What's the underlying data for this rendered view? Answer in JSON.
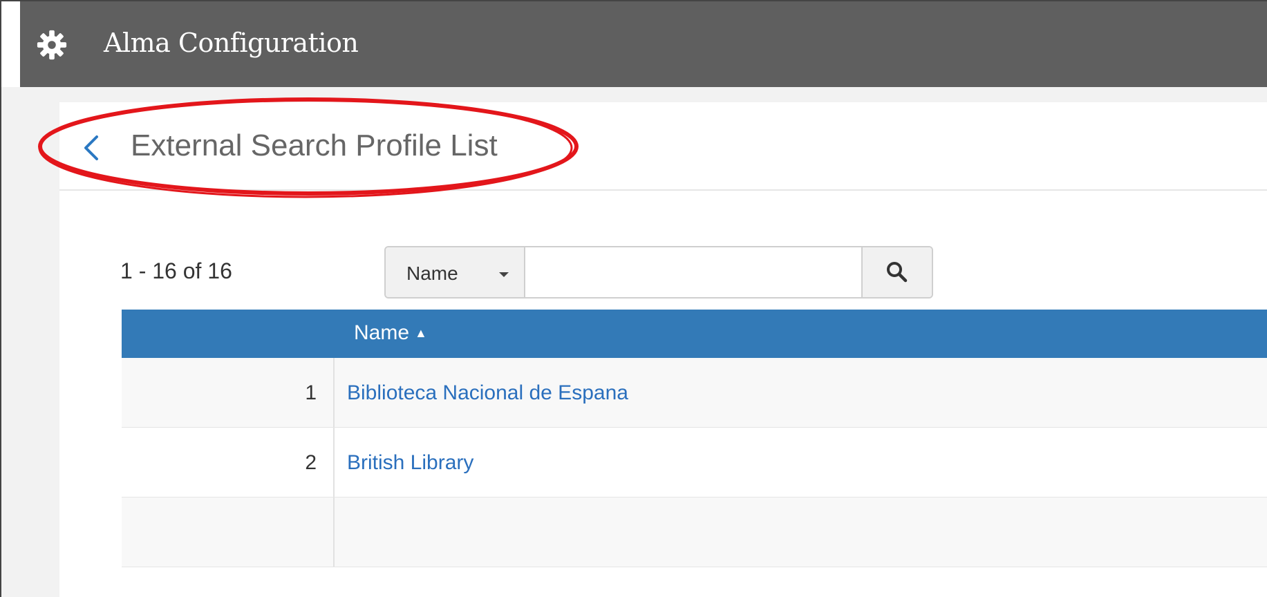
{
  "topbar": {
    "app_title": "Alma Configuration",
    "icon": "gear-icon",
    "background_color": "#5f5f5f"
  },
  "header": {
    "back_icon": "chevron-left-icon",
    "page_title": "External Search Profile List",
    "annotation_color": "#e3161b"
  },
  "list": {
    "count_text": "1 - 16 of 16",
    "search": {
      "type_label": "Name",
      "value": "",
      "placeholder": "",
      "button_icon": "search-icon"
    },
    "columns": [
      {
        "label": "Name",
        "sort_icon": "▲"
      }
    ],
    "rows": [
      {
        "index": "1",
        "name": "Biblioteca Nacional de Espana"
      },
      {
        "index": "2",
        "name": "British Library"
      }
    ],
    "header_color": "#337ab7",
    "link_color": "#2a6fbd"
  }
}
